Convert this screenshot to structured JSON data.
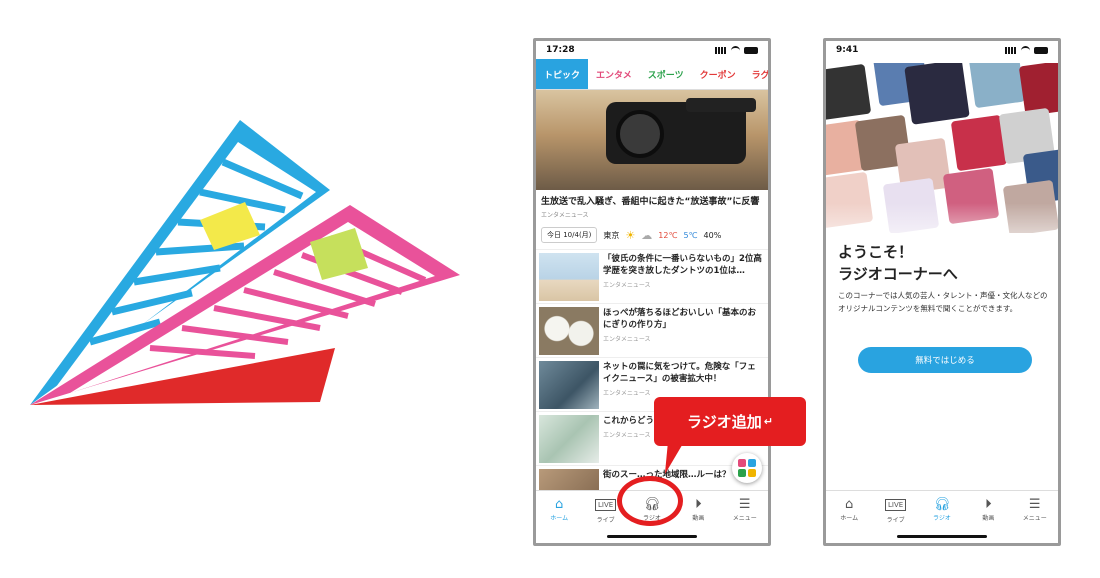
{
  "phone1": {
    "status_time": "17:28",
    "tabs": [
      "トピック",
      "エンタメ",
      "スポーツ",
      "クーポン",
      "ラグビー"
    ],
    "hero_title": "生放送で乱入騒ぎ、番組中に起きた“放送事故”に反響",
    "hero_source": "エンタメニュース",
    "weather": {
      "date": "今日 10/4(月)",
      "city": "東京",
      "high": "12℃",
      "low": "5℃",
      "rain": "40%"
    },
    "news": [
      {
        "title": "「彼氏の条件に一番いらないもの」2位高学歴を突き放したダントツの1位は…",
        "source": "エンタメニュース"
      },
      {
        "title": "ほっぺが落ちるほどおいしい「基本のおにぎりの作り方」",
        "source": "エンタメニュース"
      },
      {
        "title": "ネットの罠に気をつけて。危険な「フェイクニュース」の被害拡大中！",
        "source": "エンタメニュース"
      },
      {
        "title": "これからどう…情",
        "source": "エンタメニュース"
      },
      {
        "title": "街のスー…った地域限…ルーは？",
        "source": ""
      }
    ],
    "nav": [
      "ホーム",
      "ライブ",
      "ラジオ",
      "動画",
      "メニュー"
    ]
  },
  "callout_text": "ラジオ追加",
  "phone2": {
    "status_time": "9:41",
    "welcome_line1": "ようこそ！",
    "welcome_line2": "ラジオコーナーへ",
    "description": "このコーナーでは人気の芸人・タレント・声優・文化人などのオリジナルコンテンツを無料で聞くことができます。",
    "start_button": "無料ではじめる",
    "nav": [
      "ホーム",
      "ライブ",
      "ラジオ",
      "動画",
      "メニュー"
    ]
  },
  "colors": {
    "accent": "#29a3e0",
    "callout_red": "#e41e20",
    "logo_blue": "#29a9e1",
    "logo_pink": "#e9529a",
    "logo_red": "#e02a2a",
    "logo_yellow": "#f3e94a",
    "logo_green": "#c6e05c"
  },
  "icons": [
    "home-icon",
    "live-icon",
    "headphones-icon",
    "play-icon",
    "menu-icon"
  ]
}
